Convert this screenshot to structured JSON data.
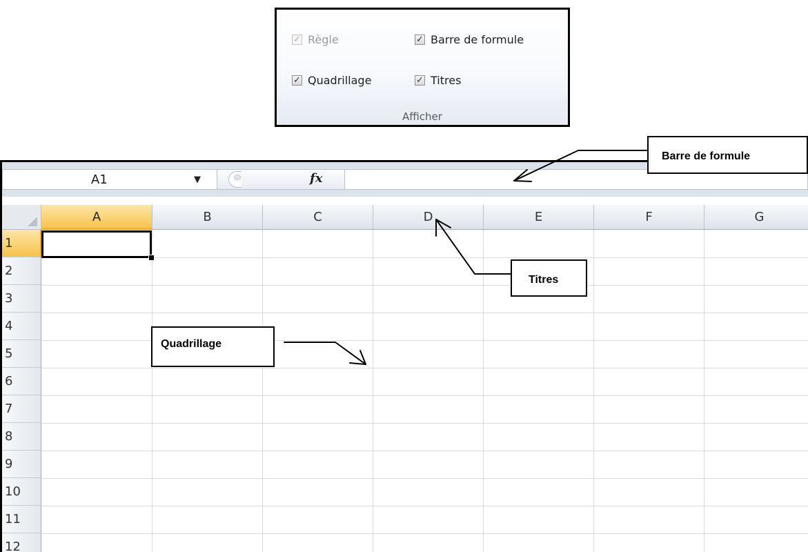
{
  "ribbon": {
    "group_label": "Afficher",
    "options": [
      {
        "label": "Règle",
        "checked": true,
        "enabled": false
      },
      {
        "label": "Barre de formule",
        "checked": true,
        "enabled": true
      },
      {
        "label": "Quadrillage",
        "checked": true,
        "enabled": true
      },
      {
        "label": "Titres",
        "checked": true,
        "enabled": true
      }
    ]
  },
  "formula_bar": {
    "name_box": "A1",
    "fx_symbol": "fx",
    "formula_value": ""
  },
  "sheet": {
    "columns": [
      "A",
      "B",
      "C",
      "D",
      "E",
      "F",
      "G"
    ],
    "rows": [
      "1",
      "2",
      "3",
      "4",
      "5",
      "6",
      "7",
      "8",
      "9",
      "10",
      "11",
      "12"
    ],
    "active_cell": "A1",
    "accent_color": "#f7c34c"
  },
  "callouts": {
    "barre_de_formule": "Barre de formule",
    "titres": "Titres",
    "quadrillage": "Quadrillage"
  }
}
